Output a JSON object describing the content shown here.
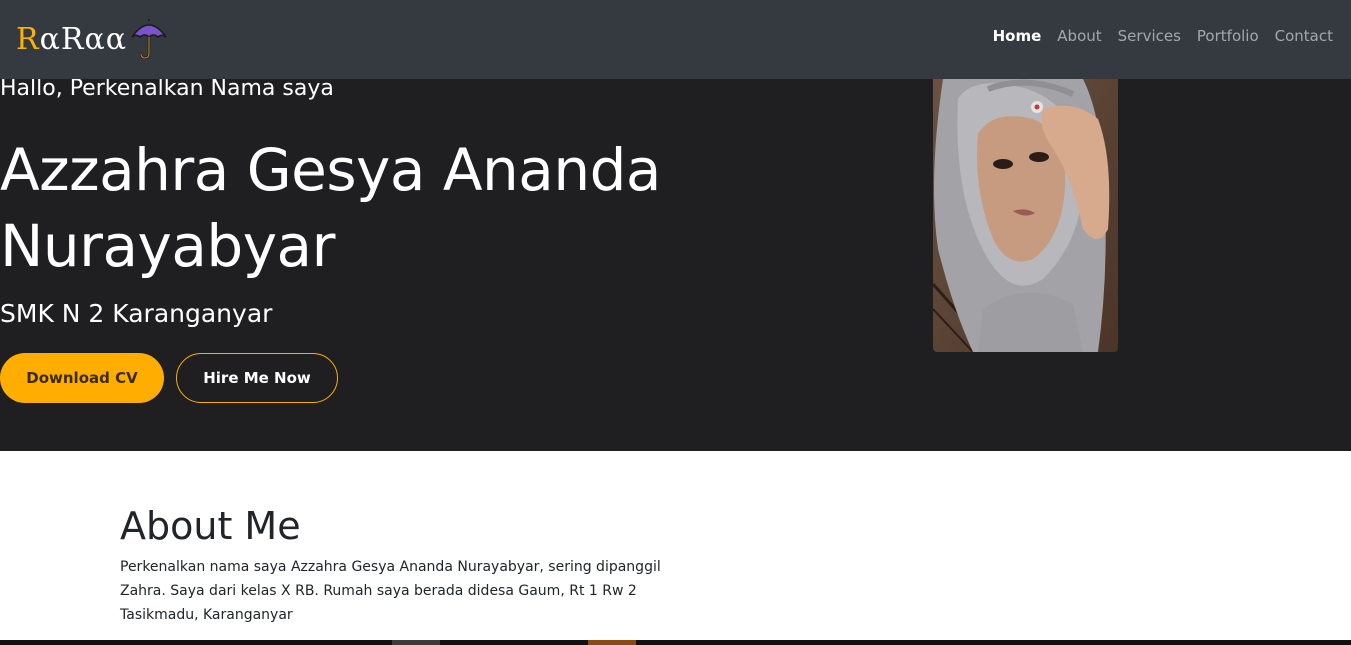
{
  "navbar": {
    "brand": {
      "first_letter": "R",
      "rest": "αRαα",
      "icon": "umbrella-icon"
    },
    "links": [
      {
        "label": "Home",
        "active": true
      },
      {
        "label": "About",
        "active": false
      },
      {
        "label": "Services",
        "active": false
      },
      {
        "label": "Portfolio",
        "active": false
      },
      {
        "label": "Contact",
        "active": false
      }
    ]
  },
  "hero": {
    "greeting": "Hallo, Perkenalkan Nama saya",
    "name": "Azzahra Gesya Ananda Nurayabyar",
    "school": "SMK N 2 Karanganyar",
    "download_button": "Download CV",
    "hire_button": "Hire Me Now",
    "photo": "profile-photo"
  },
  "about": {
    "title": "About Me",
    "text": "Perkenalkan nama saya Azzahra Gesya Ananda Nurayabyar, sering dipanggil Zahra. Saya dari kelas X RB. Rumah saya berada didesa Gaum, Rt 1 Rw 2 Tasikmadu, Karanganyar"
  },
  "colors": {
    "navbar_bg": "#343a40",
    "hero_bg": "#1f1f21",
    "accent": "#ffae00",
    "umbrella": "#7b52c9"
  }
}
